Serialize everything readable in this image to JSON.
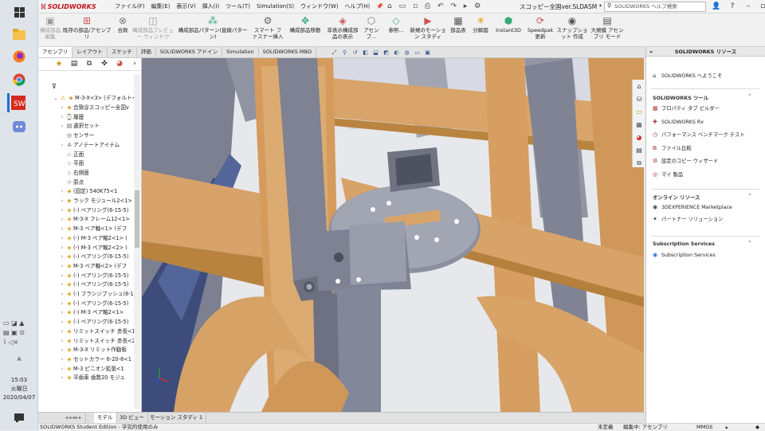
{
  "app": {
    "logo_text": "SOLIDWORKS",
    "doc_title": "スコッピー全国ver.SLDASM *",
    "help_search_placeholder": "SOLIDWORKS ヘルプ検索"
  },
  "colors": {
    "accent": "#1a6fd6",
    "brand": "#c1141b",
    "part_orange": "#d9a46a",
    "part_gray": "#8b909c"
  },
  "menu": [
    "ファイル(F)",
    "編集(E)",
    "表示(V)",
    "挿入(I)",
    "ツール(T)",
    "Simulation(S)",
    "ウィンドウ(W)",
    "ヘルプ(H)"
  ],
  "toolbar": {
    "btn1": "構成部品編集",
    "btn2": "既存の部品/アセンブリ",
    "btn3": "合致",
    "btn4": "構成部品プレビュー ウィンドウ",
    "btn5": "構成部品パターン(直線パターン)",
    "btn6": "スマート ファスナー挿入",
    "btn7": "構成部品移動",
    "btn8": "非表示構成部品の表示",
    "btn9": "アセンブ...",
    "btn10": "参照...",
    "btn11": "新規のモーション スタディ",
    "btn12": "部品表",
    "btn13": "分解図",
    "btn14": "Instant3D",
    "btn15": "Speedpak 更新",
    "btn16": "スナップショット 作成",
    "btn17": "大規模 アセンブリ モード"
  },
  "cm_tabs": [
    "アセンブリ",
    "レイアウト",
    "スケッチ",
    "評価",
    "SOLIDWORKS アドイン",
    "Simulation",
    "SOLIDWORKS MBD"
  ],
  "tree": {
    "root": "M-3-X<3> (デフォルト<",
    "items": [
      "合致@スコッピー全国v",
      "履歴",
      "選択セット",
      "センサー",
      "アノテートアイテム",
      "正面",
      "平面",
      "右側面",
      "原点",
      "(固定) 540K75<1",
      "ラック モジュール2<1> (",
      "(-) ベアリング(6-15-5)",
      "M-3-X フレーム12<1>",
      "M-3 ベア軸<1> (デフ",
      "(-) M-3 ベア軸2<1> (",
      "(-) M-3 ベア軸2<2> (",
      "(-) ベアリング(6-15-5)",
      "M-3 ベア軸<2> (デフ",
      "(-) ベアリング(6-15-5)",
      "(-) ベアリング(6-15-5)",
      "(-) フランジブッシュ(8-1",
      "(-) ベアリング(6-15-5)",
      "(-) M-3 ベア軸2<1>",
      "(-) ベアリング(6-15-5)",
      "リミットスイッチ 赤長<1",
      "リミットスイッチ 赤長<2",
      "M-3-X リミット作動板",
      "セットカラー 6-20-8<1",
      "M-3 ピニオン拡張<1",
      "平歯車 歯数20 モジュ"
    ]
  },
  "resources": {
    "header": "SOLIDWORKS リソース",
    "welcome": "SOLIDWORKS へようこそ",
    "tools_title": "SOLIDWORKS ツール",
    "tools": [
      "プロパティ タブ ビルダー",
      "SOLIDWORKS Rx",
      "パフォーマンス ベンチマーク テスト",
      "ファイル比較",
      "設定のコピー ウィザード",
      "マイ 製品"
    ],
    "online_title": "オンライン リソース",
    "online": [
      "3DEXPERIENCE Marketplace",
      "パートナー ソリューション"
    ],
    "sub_title": "Subscription Services",
    "sub": [
      "Subscription Services"
    ]
  },
  "bottom_tabs": [
    "モデル",
    "3D ビュー",
    "モーション スタディ 1"
  ],
  "status": {
    "left": "SOLIDWORKS Student Edition - 学究的使用のみ",
    "s1": "未定義",
    "s2": "編集中: アセンブリ",
    "s3": "MMGS"
  },
  "clock": {
    "time": "15:03",
    "day": "火曜日",
    "date": "2020/04/07",
    "ime": "A"
  }
}
